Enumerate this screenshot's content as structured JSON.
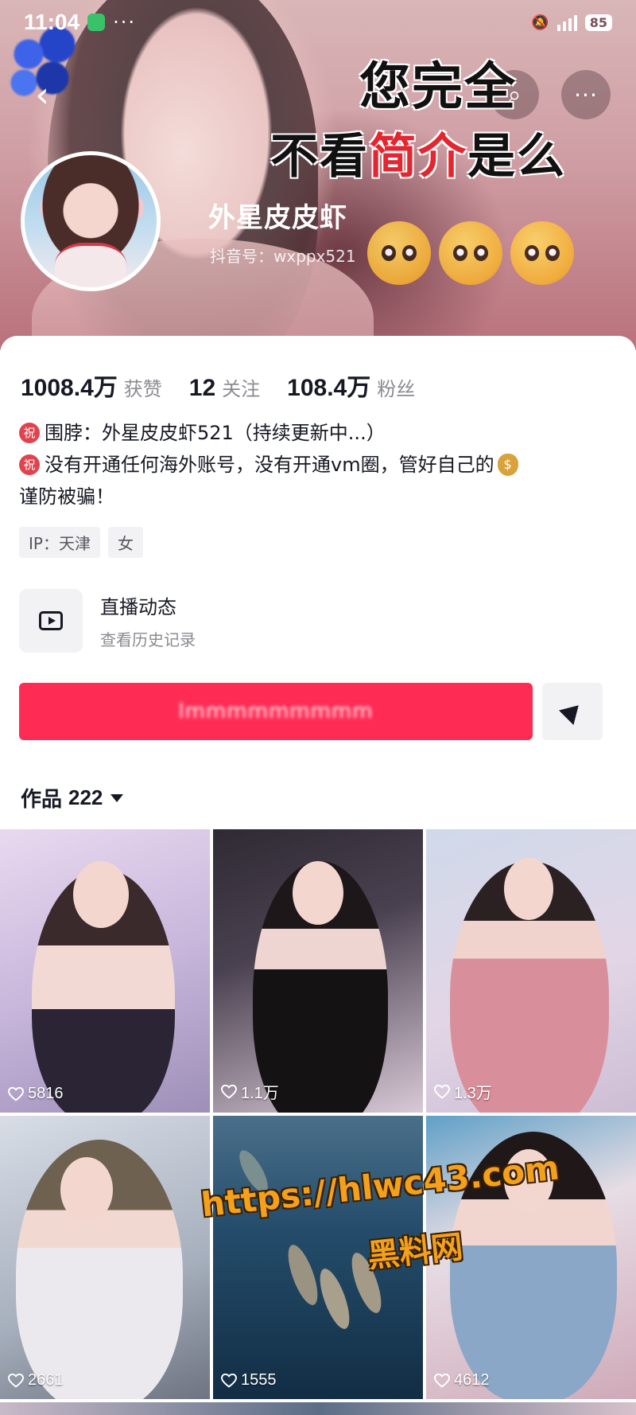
{
  "status_bar": {
    "time": "11:04",
    "more": "···",
    "battery": "85"
  },
  "header": {
    "back_glyph": "‹",
    "search_glyph": "⌕",
    "more_glyph": "···",
    "banner_line1": "您完全",
    "banner_line2_pre": "不看",
    "banner_line2_hl": "简介",
    "banner_line2_post": "是么",
    "nickname": "外星皮皮虾",
    "douyin_id": "抖音号：wxppx521"
  },
  "stats": [
    {
      "value": "1008.4万",
      "label": "获赞"
    },
    {
      "value": "12",
      "label": "关注"
    },
    {
      "value": "108.4万",
      "label": "粉丝"
    }
  ],
  "bio": {
    "badge": "祝",
    "line1": "围脖：外星皮皮虾521（持续更新中...）",
    "line2": "没有开通任何海外账号，没有开通vm圈，管好自己的",
    "money_glyph": "$",
    "line3": "谨防被骗！"
  },
  "tags": {
    "ip": "IP：天津",
    "gender": "女"
  },
  "live_entry": {
    "title": "直播动态",
    "subtitle": "查看历史记录"
  },
  "follow_button": {
    "label": "lmmmmmmmmm"
  },
  "works": {
    "label": "作品",
    "count": "222"
  },
  "grid": [
    {
      "likes": "5816"
    },
    {
      "likes": "1.1万"
    },
    {
      "likes": "1.3万"
    },
    {
      "likes": "2661"
    },
    {
      "likes": "1555"
    },
    {
      "likes": "4612"
    }
  ],
  "watermark": {
    "url": "https://hlwc43.com",
    "name": "黑料网"
  },
  "colors": {
    "accent": "#fe2c55",
    "highlight": "#e3262f",
    "watermark": "#f3a11c"
  }
}
